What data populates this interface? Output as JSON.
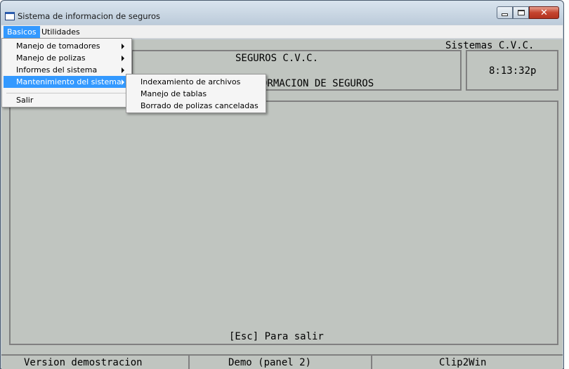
{
  "window": {
    "title": "Sistema de informacion de seguros"
  },
  "menubar": {
    "items": [
      {
        "label": "Basicos"
      },
      {
        "label": "Utilidades"
      }
    ]
  },
  "basicos_menu": {
    "items": [
      {
        "label": "Manejo de tomadores"
      },
      {
        "label": "Manejo de polizas"
      },
      {
        "label": "Informes del sistema"
      },
      {
        "label": "Mantenimiento del sistema"
      },
      {
        "label": "Salir"
      }
    ]
  },
  "mantenimiento_submenu": {
    "items": [
      {
        "label": "Indexamiento de archivos"
      },
      {
        "label": "Manejo de tablas"
      },
      {
        "label": "Borrado de polizas canceladas"
      }
    ]
  },
  "screen": {
    "systems_label": "Sistemas C.V.C.",
    "company_name": "SEGUROS C.V.C.",
    "system_name_partial": "ORMACION DE SEGUROS",
    "clock": "8:13:32p",
    "esc_hint": "[Esc] Para salir"
  },
  "statusbar": {
    "version": "Version demostracion",
    "demo": "Demo (panel 2)",
    "clip": "Clip2Win"
  },
  "colors": {
    "menu_highlight": "#3399ff",
    "dos_background": "#c0c5c0"
  }
}
